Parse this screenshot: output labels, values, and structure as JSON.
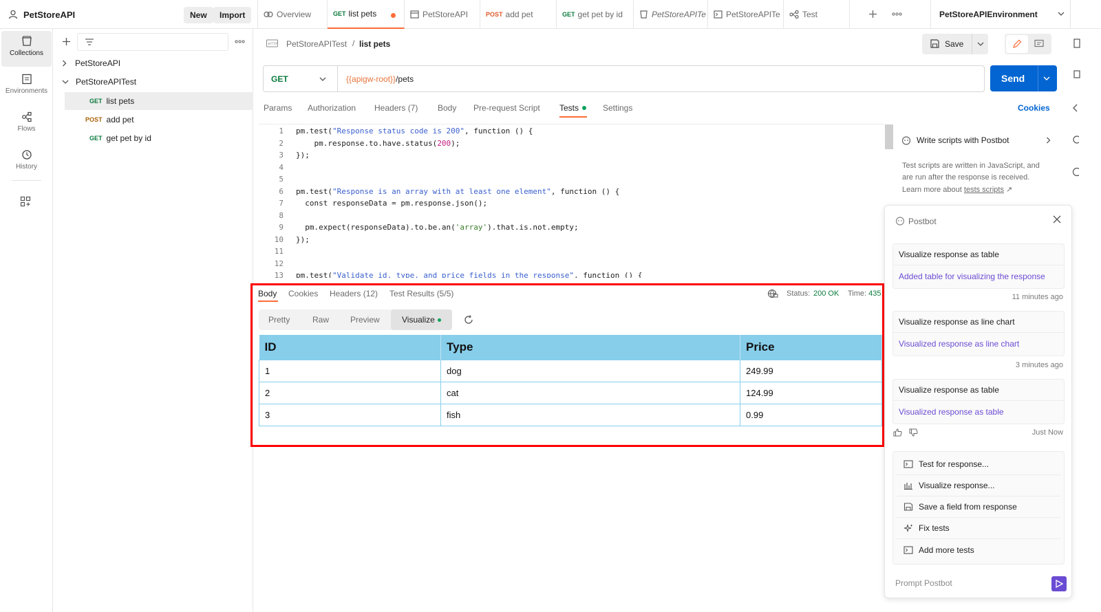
{
  "workspace": {
    "name": "PetStoreAPI",
    "new_label": "New",
    "import_label": "Import"
  },
  "tabs": [
    {
      "label": "Overview",
      "method": ""
    },
    {
      "label": "list pets",
      "method": "GET"
    },
    {
      "label": "PetStoreAPI",
      "method": ""
    },
    {
      "label": "add pet",
      "method": "POST"
    },
    {
      "label": "get pet by id",
      "method": "GET"
    },
    {
      "label": "PetStoreAPITe",
      "method": ""
    },
    {
      "label": "PetStoreAPITe",
      "method": ""
    },
    {
      "label": "Test",
      "method": ""
    }
  ],
  "environment": "PetStoreAPIEnvironment",
  "rail": [
    {
      "label": "Collections"
    },
    {
      "label": "Environments"
    },
    {
      "label": "Flows"
    },
    {
      "label": "History"
    }
  ],
  "tree": {
    "collections": [
      "PetStoreAPI",
      "PetStoreAPITest"
    ],
    "requests": [
      {
        "method": "GET",
        "label": "list pets"
      },
      {
        "method": "POST",
        "label": "add pet"
      },
      {
        "method": "GET",
        "label": "get pet by id"
      }
    ]
  },
  "request": {
    "breadcrumb_parent": "PetStoreAPITest",
    "breadcrumb_sep": "/",
    "breadcrumb_current": "list pets",
    "save_label": "Save",
    "method": "GET",
    "url_var": "{{apigw-root}}",
    "url_path": "/pets",
    "send_label": "Send",
    "cookies_label": "Cookies",
    "tabs": [
      "Params",
      "Authorization",
      "Headers (7)",
      "Body",
      "Pre-request Script",
      "Tests",
      "Settings"
    ]
  },
  "code": {
    "line_numbers": [
      "1",
      "2",
      "3",
      "4",
      "5",
      "6",
      "7",
      "8",
      "9",
      "10",
      "11",
      "12",
      "13"
    ],
    "l1_a": "pm.test(",
    "l1_str": "\"Response status code is 200\"",
    "l1_b": ", function () {",
    "l2_a": "    pm.response.to.have.status(",
    "l2_num": "200",
    "l2_b": ");",
    "l3": "});",
    "l6_a": "pm.test(",
    "l6_str": "\"Response is an array with at least one element\"",
    "l6_b": ", function () {",
    "l7": "  const responseData = pm.response.json();",
    "l9_a": "  pm.expect(responseData).to.be.an(",
    "l9_str": "'array'",
    "l9_b": ").that.is.not.empty;",
    "l10": "});",
    "l13_a": "pm.test(",
    "l13_str": "\"Validate id, type, and price fields in the response\"",
    "l13_b": ", function () {"
  },
  "sidepanel": {
    "title": "Write scripts with Postbot",
    "desc1": "Test scripts are written in JavaScript, and",
    "desc2": "are run after the response is received.",
    "desc3_a": "Learn more about ",
    "desc3_link": "tests scripts",
    "desc3_arrow": "↗"
  },
  "response": {
    "tabs": [
      "Body",
      "Cookies",
      "Headers (12)",
      "Test Results (5/5)"
    ],
    "status_label": "Status:",
    "status_value": "200 OK",
    "time_label": "Time:",
    "time_value": "435",
    "view_modes": [
      "Pretty",
      "Raw",
      "Preview",
      "Visualize"
    ],
    "table": {
      "headers": [
        "ID",
        "Type",
        "Price"
      ],
      "rows": [
        [
          "1",
          "dog",
          "249.99"
        ],
        [
          "2",
          "cat",
          "124.99"
        ],
        [
          "3",
          "fish",
          "0.99"
        ]
      ]
    }
  },
  "postbot": {
    "title": "Postbot",
    "history": [
      {
        "q": "Visualize response as table",
        "a": "Added table for visualizing the response",
        "time": "11 minutes ago"
      },
      {
        "q": "Visualize response as line chart",
        "a": "Visualized response as line chart",
        "time": "3 minutes ago"
      },
      {
        "q": "Visualize response as table",
        "a": "Visualized response as table",
        "time": "Just Now"
      }
    ],
    "suggestions": [
      "Test for response...",
      "Visualize response...",
      "Save a field from response",
      "Fix tests",
      "Add more tests"
    ],
    "prompt_placeholder": "Prompt Postbot"
  },
  "colors": {
    "accent": "#ff6c37",
    "send": "#0265d2",
    "highlight": "#ff0000",
    "table_header": "#87ceeb",
    "postbot_link": "#6a4bd3"
  }
}
